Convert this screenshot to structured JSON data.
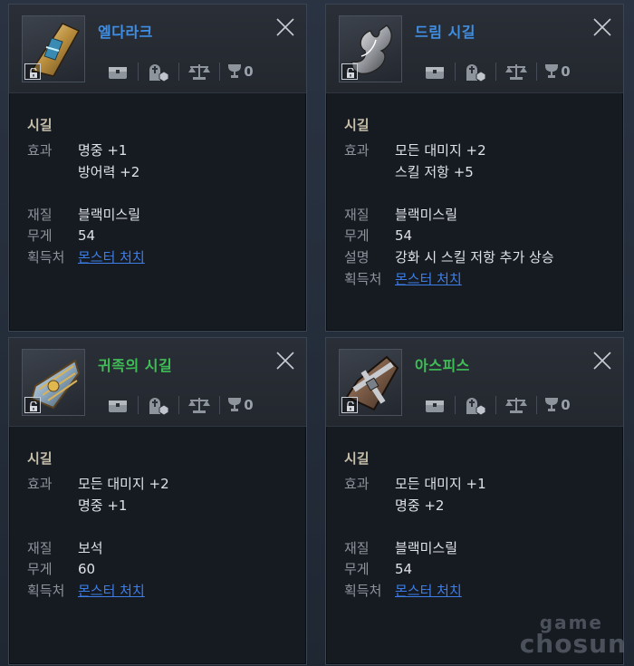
{
  "colors": {
    "title_blue": "#3f8fe4",
    "title_green": "#3fbe56",
    "link": "#3d7de8",
    "category": "#c6bfa9"
  },
  "icons": [
    "chest-icon",
    "gravestone-gem-icon",
    "scales-icon",
    "trophy-icon"
  ],
  "labels": {
    "effect": "효과",
    "material": "재질",
    "weight": "무게",
    "description": "설명",
    "source": "획득처"
  },
  "cards": [
    {
      "title": "엘다라크",
      "rarity_color": "#3f8fe4",
      "trophy_count": "0",
      "category": "시길",
      "effects": [
        "명중 +1",
        "방어력 +2"
      ],
      "material": "블랙미스릴",
      "weight": "54",
      "description": "",
      "source": "몬스터 처치"
    },
    {
      "title": "드림 시길",
      "rarity_color": "#3f8fe4",
      "trophy_count": "0",
      "category": "시길",
      "effects": [
        "모든 대미지 +2",
        "스킬 저항 +5"
      ],
      "material": "블랙미스릴",
      "weight": "54",
      "description": "강화 시 스킬 저항 추가 상승",
      "source": "몬스터 처치"
    },
    {
      "title": "귀족의 시길",
      "rarity_color": "#3fbe56",
      "trophy_count": "0",
      "category": "시길",
      "effects": [
        "모든 대미지 +2",
        "명중 +1"
      ],
      "material": "보석",
      "weight": "60",
      "description": "",
      "source": "몬스터 처치"
    },
    {
      "title": "아스피스",
      "rarity_color": "#3fbe56",
      "trophy_count": "0",
      "category": "시길",
      "effects": [
        "모든 대미지 +1",
        "명중 +2"
      ],
      "material": "블랙미스릴",
      "weight": "54",
      "description": "",
      "source": "몬스터 처치"
    }
  ],
  "watermark": {
    "line1": "game",
    "line2": "chosun"
  }
}
